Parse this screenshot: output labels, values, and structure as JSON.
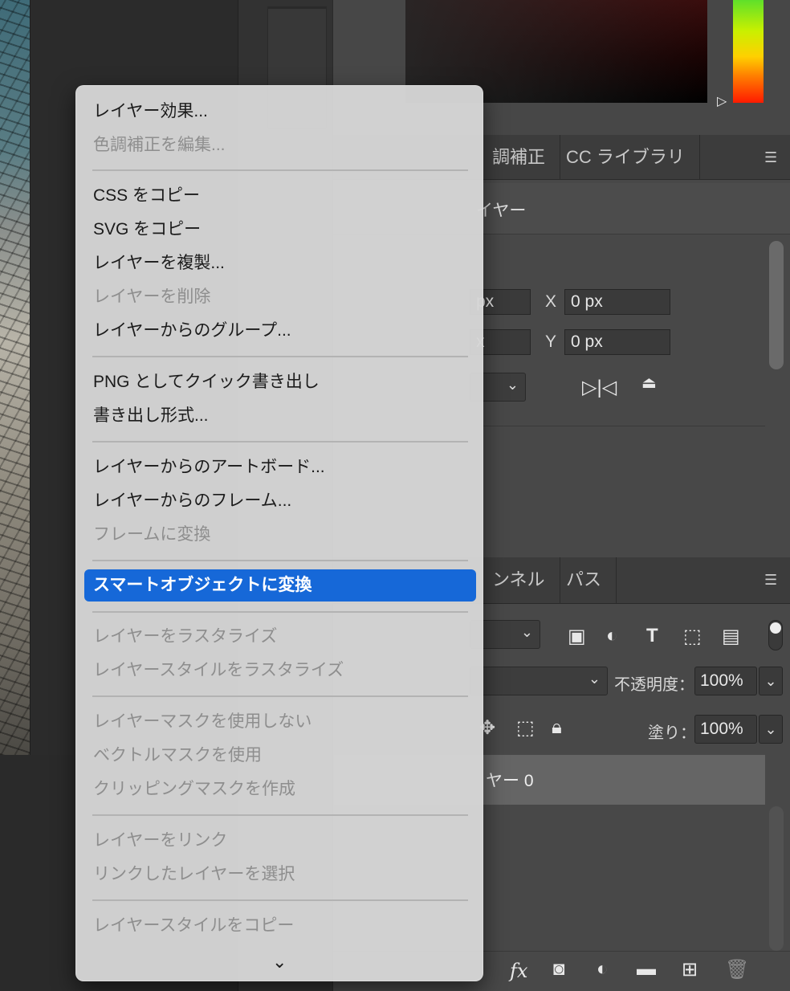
{
  "context_menu": {
    "items": [
      {
        "label": "レイヤー効果...",
        "enabled": true
      },
      {
        "label": "色調補正を編集...",
        "enabled": false
      },
      {
        "label": "CSS をコピー",
        "enabled": true
      },
      {
        "label": "SVG をコピー",
        "enabled": true
      },
      {
        "label": "レイヤーを複製...",
        "enabled": true
      },
      {
        "label": "レイヤーを削除",
        "enabled": false
      },
      {
        "label": "レイヤーからのグループ...",
        "enabled": true
      },
      {
        "label": "PNG としてクイック書き出し",
        "enabled": true
      },
      {
        "label": "書き出し形式...",
        "enabled": true
      },
      {
        "label": "レイヤーからのアートボード...",
        "enabled": true
      },
      {
        "label": "レイヤーからのフレーム...",
        "enabled": true
      },
      {
        "label": "フレームに変換",
        "enabled": false
      },
      {
        "label": "スマートオブジェクトに変換",
        "enabled": true,
        "highlighted": true
      },
      {
        "label": "レイヤーをラスタライズ",
        "enabled": false
      },
      {
        "label": "レイヤースタイルをラスタライズ",
        "enabled": false
      },
      {
        "label": "レイヤーマスクを使用しない",
        "enabled": false
      },
      {
        "label": "ベクトルマスクを使用",
        "enabled": false
      },
      {
        "label": "クリッピングマスクを作成",
        "enabled": false
      },
      {
        "label": "レイヤーをリンク",
        "enabled": false
      },
      {
        "label": "リンクしたレイヤーを選択",
        "enabled": false
      },
      {
        "label": "レイヤースタイルをコピー",
        "enabled": false
      }
    ],
    "more_icon": "chevron-down-icon"
  },
  "properties_panel": {
    "tabs": [
      "調補正",
      "CC ライブラリ"
    ],
    "subtitle": "イヤー",
    "w_value": "px",
    "h_value": "x",
    "x_label": "X",
    "x_value": "0 px",
    "y_label": "Y",
    "y_value": "0 px"
  },
  "layers_panel": {
    "tabs": [
      "ンネル",
      "パス"
    ],
    "opacity_label": "不透明度：",
    "opacity_value": "100%",
    "fill_label": "塗り：",
    "fill_value": "100%",
    "layer_name": "ヤー 0",
    "bottom_fx": "fx"
  },
  "colors": {
    "highlight": "#1668d8",
    "menu_bg": "#d6d6d6",
    "panel_bg": "#484848"
  }
}
